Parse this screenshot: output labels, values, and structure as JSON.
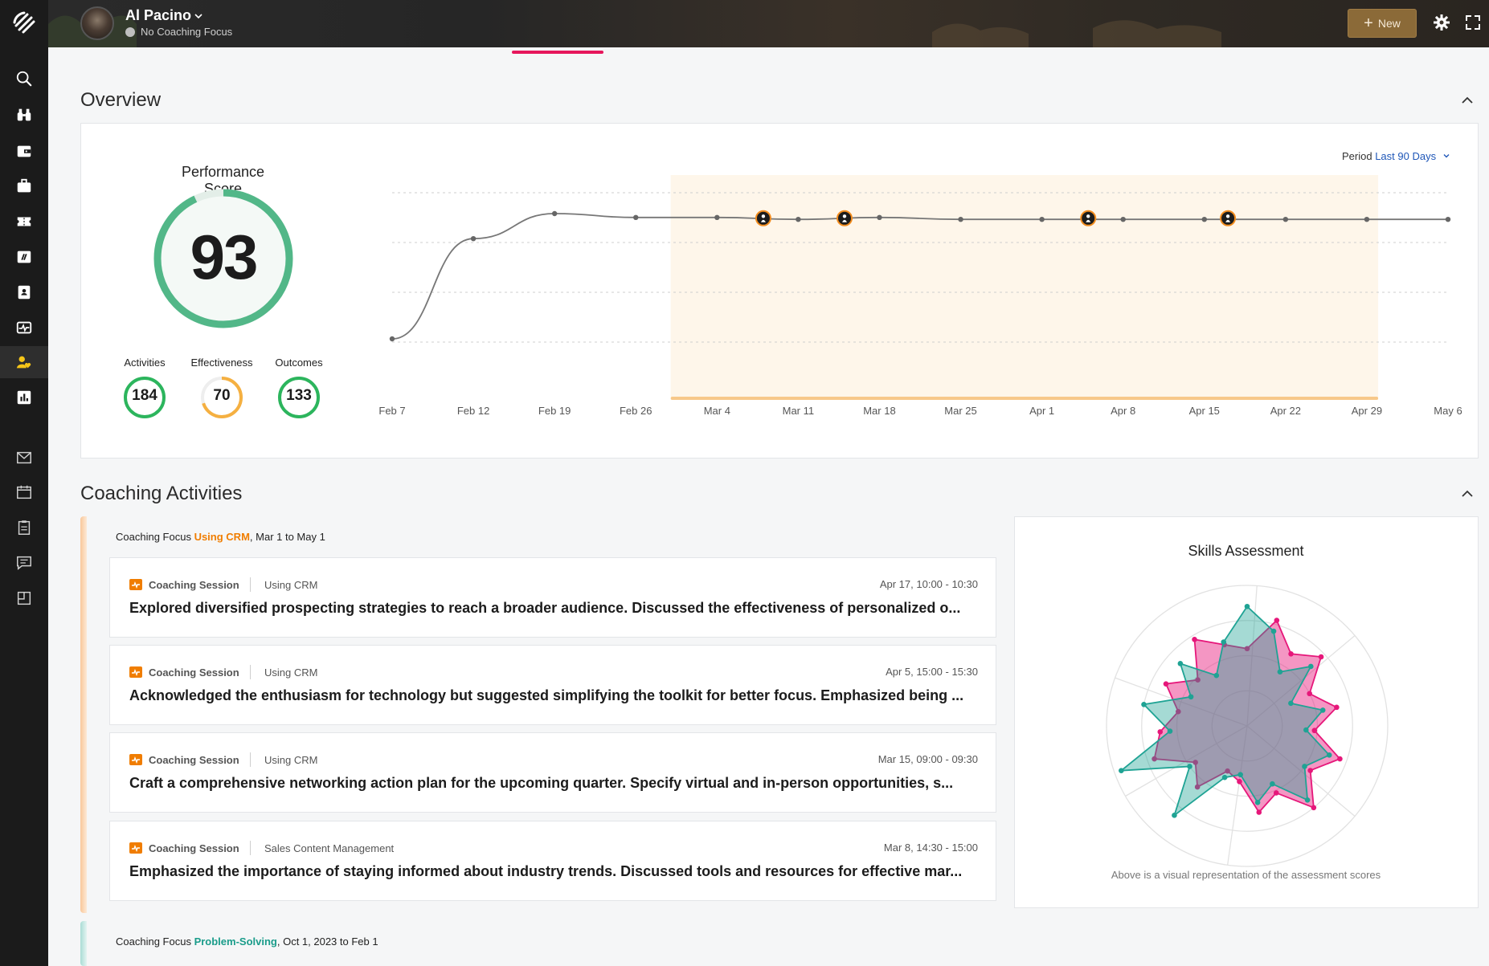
{
  "header": {
    "user_name": "Al Pacino",
    "coaching_focus": "No Coaching Focus",
    "new_button": "New"
  },
  "overview": {
    "title": "Overview",
    "performance_title": "Performance Score",
    "score": "93",
    "score_value": 93,
    "metrics": [
      {
        "label": "Activities",
        "value": "184",
        "color": "#2cb55d",
        "fill": 1.0
      },
      {
        "label": "Effectiveness",
        "value": "70",
        "color": "#f5b041",
        "fill": 0.7
      },
      {
        "label": "Outcomes",
        "value": "133",
        "color": "#2cb55d",
        "fill": 1.0
      }
    ],
    "period_label": "Period",
    "period_value": "Last 90 Days"
  },
  "chart_data": {
    "type": "line",
    "x": [
      "Feb 7",
      "Feb 12",
      "Feb 19",
      "Feb 26",
      "Mar 4",
      "Mar 11",
      "Mar 18",
      "Mar 25",
      "Apr 1",
      "Apr 8",
      "Apr 15",
      "Apr 22",
      "Apr 29",
      "May 6"
    ],
    "values": [
      20,
      72,
      85,
      83,
      83,
      82,
      83,
      82,
      82,
      82,
      82,
      82,
      82,
      82
    ],
    "ylim": [
      0,
      100
    ],
    "highlight_range": [
      "Mar 1",
      "May 1"
    ],
    "event_markers": [
      "Mar 8",
      "Mar 15",
      "Apr 5",
      "Apr 17"
    ],
    "grid": true
  },
  "coaching": {
    "title": "Coaching Activities",
    "focus1_prefix": "Coaching Focus ",
    "focus1_name": "Using CRM",
    "focus1_range": ", Mar 1 to May 1",
    "focus2_prefix": "Coaching Focus ",
    "focus2_name": "Problem-Solving",
    "focus2_range": ", Oct 1, 2023 to Feb 1",
    "sessions": [
      {
        "type": "Coaching Session",
        "focus": "Using CRM",
        "date": "Apr 17, 10:00 - 10:30",
        "text": "Explored diversified prospecting strategies to reach a broader audience. Discussed the effectiveness of personalized o..."
      },
      {
        "type": "Coaching Session",
        "focus": "Using CRM",
        "date": "Apr 5, 15:00 - 15:30",
        "text": "Acknowledged the enthusiasm for technology but suggested simplifying the toolkit for better focus. Emphasized being ..."
      },
      {
        "type": "Coaching Session",
        "focus": "Using CRM",
        "date": "Mar 15, 09:00 - 09:30",
        "text": "Craft a comprehensive networking action plan for the upcoming quarter. Specify virtual and in-person opportunities, s..."
      },
      {
        "type": "Coaching Session",
        "focus": "Sales Content Management",
        "date": "Mar 8, 14:30 - 15:00",
        "text": "Emphasized the importance of staying informed about industry trends. Discussed tools and resources for effective mar..."
      }
    ]
  },
  "skills": {
    "title": "Skills Assessment",
    "caption": "Above is a visual representation of the assessment scores",
    "colors": {
      "series_a": "#e6177a",
      "series_b": "#1fa394"
    },
    "series_a": [
      0.55,
      0.78,
      0.6,
      0.72,
      0.5,
      0.65,
      0.48,
      0.7,
      0.55,
      0.75,
      0.52,
      0.62,
      0.4,
      0.35,
      0.56,
      0.45,
      0.7,
      0.62,
      0.5,
      0.65,
      0.48,
      0.72,
      0.6
    ],
    "series_b": [
      0.85,
      0.7,
      0.45,
      0.62,
      0.35,
      0.55,
      0.42,
      0.62,
      0.5,
      0.68,
      0.45,
      0.55,
      0.35,
      0.4,
      0.82,
      0.5,
      0.95,
      0.55,
      0.75,
      0.45,
      0.65,
      0.42,
      0.62
    ]
  }
}
